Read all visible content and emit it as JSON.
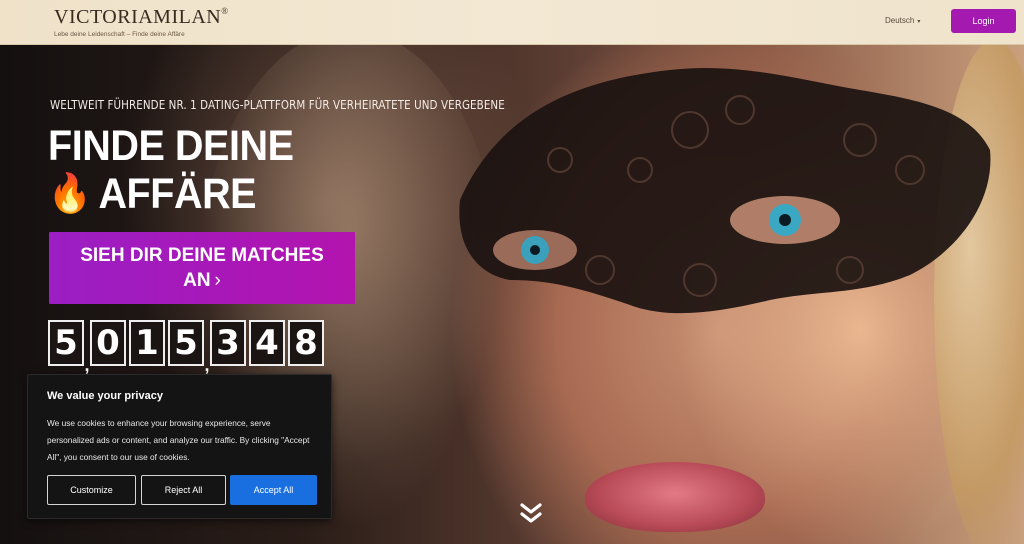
{
  "header": {
    "logo_text": "VictoriaMilan",
    "logo_reg": "®",
    "logo_tagline": "Lebe deine Leidenschaft – Finde deine Affäre",
    "language": "Deutsch",
    "login_label": "Login"
  },
  "hero": {
    "subtitle": "WELTWEIT FÜHRENDE NR. 1 DATING-PLATTFORM FÜR VERHEIRATETE UND VERGEBENE",
    "headline_line1": "FINDE DEINE",
    "headline_line2": "AFFÄRE",
    "flame_icon": "🔥",
    "cta_label_line1": "SIEH DIR DEINE MATCHES",
    "cta_label_line2": "AN",
    "cta_arrow": "›",
    "counter_digits": [
      "5",
      "0",
      "1",
      "5",
      "3",
      "4",
      "8"
    ],
    "counter_separator": ","
  },
  "cookie": {
    "title": "We value your privacy",
    "text": "We use cookies to enhance your browsing experience, serve personalized ads or content, and analyze our traffic. By clicking \"Accept All\", you consent to our use of cookies.",
    "customize_label": "Customize",
    "reject_label": "Reject All",
    "accept_label": "Accept All"
  },
  "colors": {
    "brand_purple": "#a41ab0",
    "accept_blue": "#1a6fe0"
  },
  "icons": {
    "scroll": "double-chevron-down-icon",
    "language_caret": "caret-down-icon",
    "flame": "flame-icon"
  }
}
